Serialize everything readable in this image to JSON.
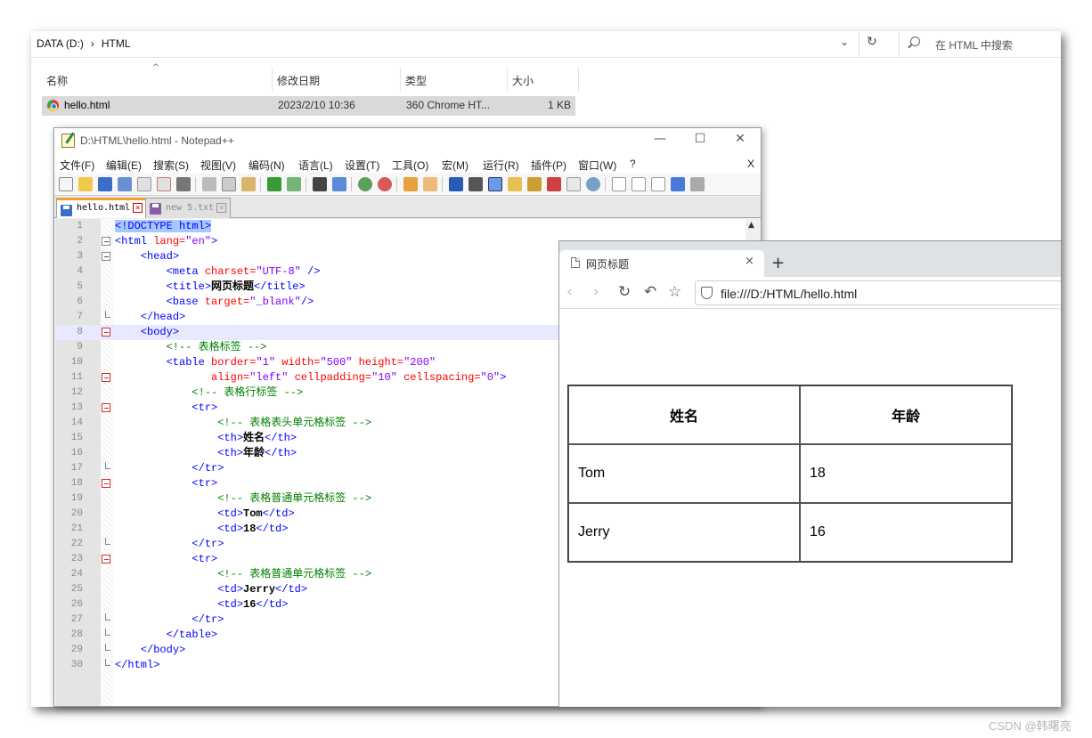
{
  "explorer": {
    "breadcrumb": [
      "DATA (D:)",
      "›",
      "HTML"
    ],
    "search_placeholder": "在 HTML 中搜索",
    "columns": [
      "名称",
      "修改日期",
      "类型",
      "大小"
    ],
    "file": {
      "name": "hello.html",
      "date": "2023/2/10 10:36",
      "type": "360 Chrome HT...",
      "size": "1 KB"
    }
  },
  "notepad": {
    "title": "D:\\HTML\\hello.html - Notepad++",
    "menu": [
      "文件(F)",
      "编辑(E)",
      "搜索(S)",
      "视图(V)",
      "编码(N)",
      "语言(L)",
      "设置(T)",
      "工具(O)",
      "宏(M)",
      "运行(R)",
      "插件(P)",
      "窗口(W)",
      "?"
    ],
    "menu_close": "X",
    "tabs": [
      "hello.html",
      "new 5.txt"
    ],
    "line_numbers": [
      "1",
      "2",
      "3",
      "4",
      "5",
      "6",
      "7",
      "8",
      "9",
      "10",
      "11",
      "12",
      "13",
      "14",
      "15",
      "16",
      "17",
      "18",
      "19",
      "20",
      "21",
      "22",
      "23",
      "24",
      "25",
      "26",
      "27",
      "28",
      "29",
      "30"
    ],
    "code": {
      "doctype": "<!DOCTYPE html>",
      "html_open": "<html",
      "lang_attr": " lang=",
      "lang_val": "\"en\"",
      "close_bracket": ">",
      "head_open": "<head>",
      "meta_open": "<meta",
      "charset_attr": " charset=",
      "charset_val": "\"UTF-8\"",
      "self_close": " />",
      "title_open": "<title>",
      "title_text": "网页标题",
      "title_close": "</title>",
      "base_open": "<base",
      "target_attr": " target=",
      "target_val": "\"_blank\"",
      "base_close": "/>",
      "head_close": "</head>",
      "body_open": "<body>",
      "comment_table": "<!-- 表格标签 -->",
      "table_open": "<table",
      "border_attr": " border=",
      "border_val": "\"1\"",
      "width_attr": " width=",
      "width_val": "\"500\"",
      "height_attr": " height=",
      "height_val": "\"200\"",
      "align_attr": "align=",
      "align_val": "\"left\"",
      "cellpadding_attr": " cellpadding=",
      "cellpadding_val": "\"10\"",
      "cellspacing_attr": " cellspacing=",
      "cellspacing_val": "\"0\"",
      "comment_tr": "<!-- 表格行标签 -->",
      "tr_open": "<tr>",
      "tr_close": "</tr>",
      "comment_th": "<!-- 表格表头单元格标签 -->",
      "th_open": "<th>",
      "th_close": "</th>",
      "comment_td": "<!-- 表格普通单元格标签 -->",
      "td_open": "<td>",
      "td_close": "</td>",
      "table_close": "</table>",
      "body_close": "</body>",
      "html_close": "</html>"
    }
  },
  "browser": {
    "tab_title": "网页标题",
    "tab_close": "×",
    "new_tab": "+",
    "url": "file:///D:/HTML/hello.html",
    "table": {
      "headers": [
        "姓名",
        "年龄"
      ],
      "rows": [
        [
          "Tom",
          "18"
        ],
        [
          "Jerry",
          "16"
        ]
      ]
    }
  },
  "watermark": "CSDN @韩曙亮"
}
